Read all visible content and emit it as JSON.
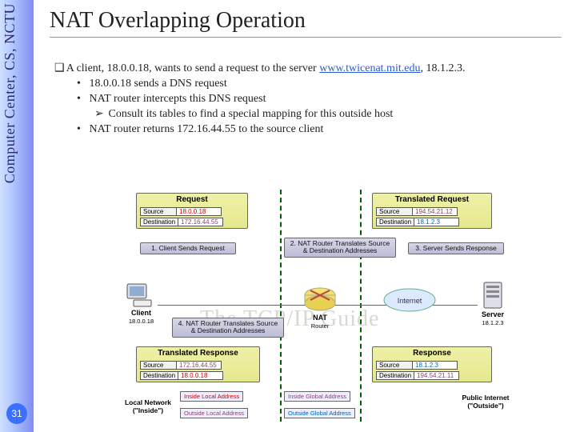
{
  "sidebar": {
    "label": "Computer Center, CS, NCTU"
  },
  "page_number": "31",
  "title": "NAT Overlapping Operation",
  "bullets": {
    "lvl1_pre": "A client, 18.0.0.18, wants to send a request to the server ",
    "lvl1_link": "www.twicenat.mit.edu",
    "lvl1_post": ", 18.1.2.3.",
    "lvl2a": "18.0.0.18 sends a DNS request",
    "lvl2b": "NAT router intercepts this DNS request",
    "lvl3a": "Consult its tables to find a special mapping for this outside host",
    "lvl2c": "NAT router returns 172.16.44.55 to the source client"
  },
  "diagram": {
    "request": {
      "title": "Request",
      "rows": [
        {
          "k": "Source",
          "v": "18.0.0.18"
        },
        {
          "k": "Destination",
          "v": "172.16.44.55"
        }
      ]
    },
    "translated_request": {
      "title": "Translated Request",
      "rows": [
        {
          "k": "Source",
          "v": "194.54.21.12"
        },
        {
          "k": "Destination",
          "v": "18.1.2.3"
        }
      ]
    },
    "translated_response": {
      "title": "Translated Response",
      "rows": [
        {
          "k": "Source",
          "v": "172.16.44.55"
        },
        {
          "k": "Destination",
          "v": "18.0.0.18"
        }
      ]
    },
    "response": {
      "title": "Response",
      "rows": [
        {
          "k": "Source",
          "v": "18.1.2.3"
        },
        {
          "k": "Destination",
          "v": "194.54.21.11"
        }
      ]
    },
    "steps": {
      "s1": "1. Client Sends Request",
      "s2": "2. NAT Router Translates Source & Destination Addresses",
      "s3": "3. Server Sends Response",
      "s4": "4. NAT Router Translates Source & Destination Addresses"
    },
    "nodes": {
      "client": "Client",
      "client_ip": "18.0.0.18",
      "nat": "NAT",
      "nat_sub": "Router",
      "internet": "Internet",
      "server": "Server",
      "server_ip": "18.1.2.3"
    },
    "nets": {
      "local": "Local Network (\"Inside\")",
      "public": "Public Internet (\"Outside\")"
    },
    "legend": {
      "ila": "Inside Local Address",
      "iga": "Inside Global Address",
      "ola": "Outside Local Address",
      "oga": "Outside Global Address"
    },
    "watermark": "The TCP/IP Guide"
  }
}
